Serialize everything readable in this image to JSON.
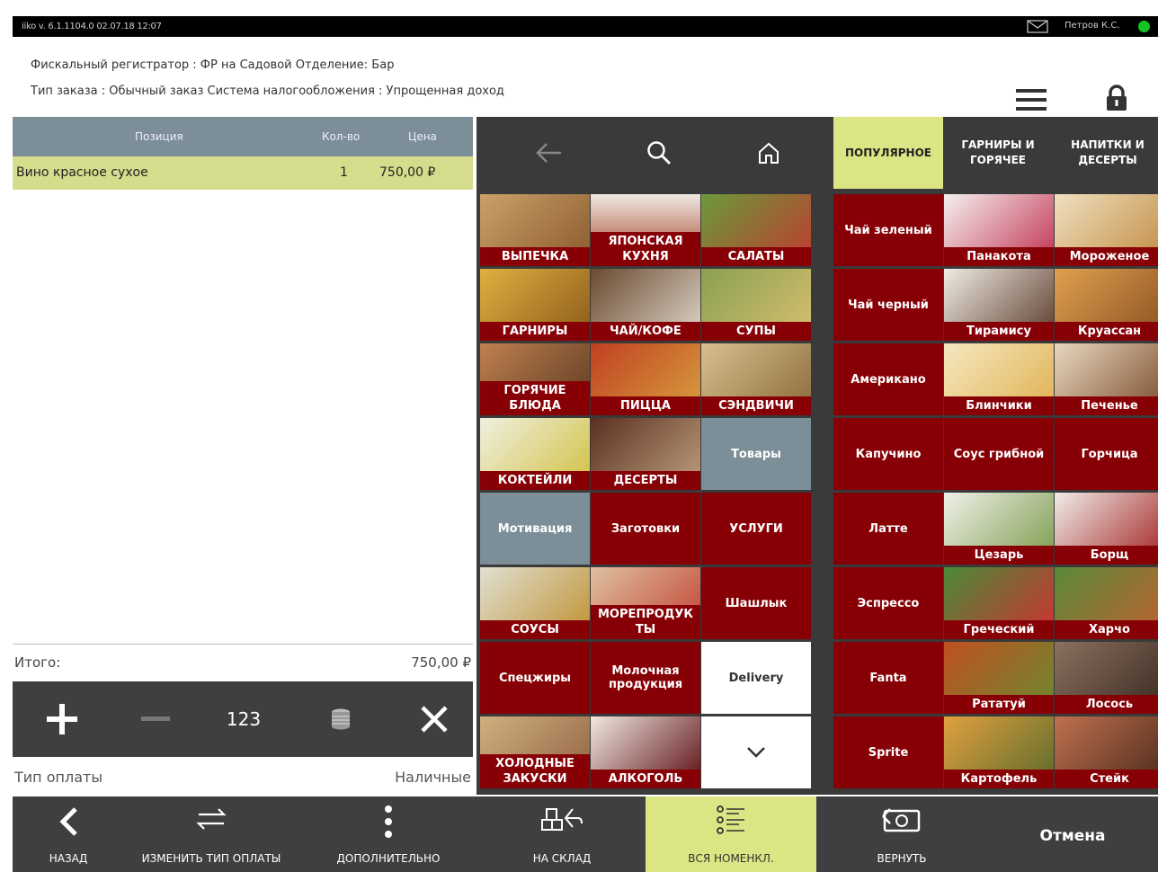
{
  "status_bar": {
    "version": "iiko v. 6.1.1104.0   02.07.18  12:07",
    "user": "Петров К.С."
  },
  "header": {
    "line1": "Фискальный регистратор : ФР на Садовой     Отделение:  Бар",
    "line2": "Тип заказа : Обычный заказ     Система налогообложения : Упрощенная доход"
  },
  "order": {
    "columns": [
      "Позиция",
      "Кол-во",
      "Цена"
    ],
    "rows": [
      {
        "name": "Вино красное сухое",
        "qty": "1",
        "price": "750,00 ₽"
      }
    ],
    "total_label": "Итого:",
    "total_value": "750,00 ₽",
    "numpad_label": "123",
    "payment_label": "Тип оплаты",
    "payment_value": "Наличные"
  },
  "nav_tabs": [
    "ПОПУЛЯРНОЕ",
    "ГАРНИРЫ И ГОРЯЧЕЕ",
    "НАПИТКИ И ДЕСЕРТЫ"
  ],
  "categories": [
    "ВЫПЕЧКА",
    "ЯПОНСКАЯ КУХНЯ",
    "САЛАТЫ",
    "ГАРНИРЫ",
    "ЧАЙ/КОФЕ",
    "СУПЫ",
    "ГОРЯЧИЕ БЛЮДА",
    "ПИЦЦА",
    "СЭНДВИЧИ",
    "КОКТЕЙЛИ",
    "ДЕСЕРТЫ",
    "Товары",
    "Мотивация",
    "Заготовки",
    "УСЛУГИ",
    "СОУСЫ",
    "МОРЕПРОДУК ТЫ",
    "Шашлык",
    "Спецжиры",
    "Молочная продукция",
    "Delivery",
    "ХОЛОДНЫЕ ЗАКУСКИ",
    "АЛКОГОЛЬ"
  ],
  "products": [
    "Чай зеленый",
    "Панакота",
    "Мороженое",
    "Чай черный",
    "Тирамису",
    "Круассан",
    "Американо",
    "Блинчики",
    "Печенье",
    "Капучино",
    "Соус грибной",
    "Горчица",
    "Латте",
    "Цезарь",
    "Борщ",
    "Эспрессо",
    "Греческий",
    "Харчо",
    "Fanta",
    "Рататуй",
    "Лосось",
    "Sprite",
    "Картофель",
    "Стейк"
  ],
  "bottom_buttons": [
    "НАЗАД",
    "ИЗМЕНИТЬ ТИП ОПЛАТЫ",
    "ДОПОЛНИТЕЛЬНО",
    "НА СКЛАД",
    "ВСЯ НОМЕНКЛ.",
    "ВЕРНУТЬ",
    "Отмена"
  ],
  "colors": {
    "accent_red": "#870006",
    "highlight": "#dce584",
    "panel_gray": "#7c8e98",
    "dark": "#3d3f40"
  }
}
